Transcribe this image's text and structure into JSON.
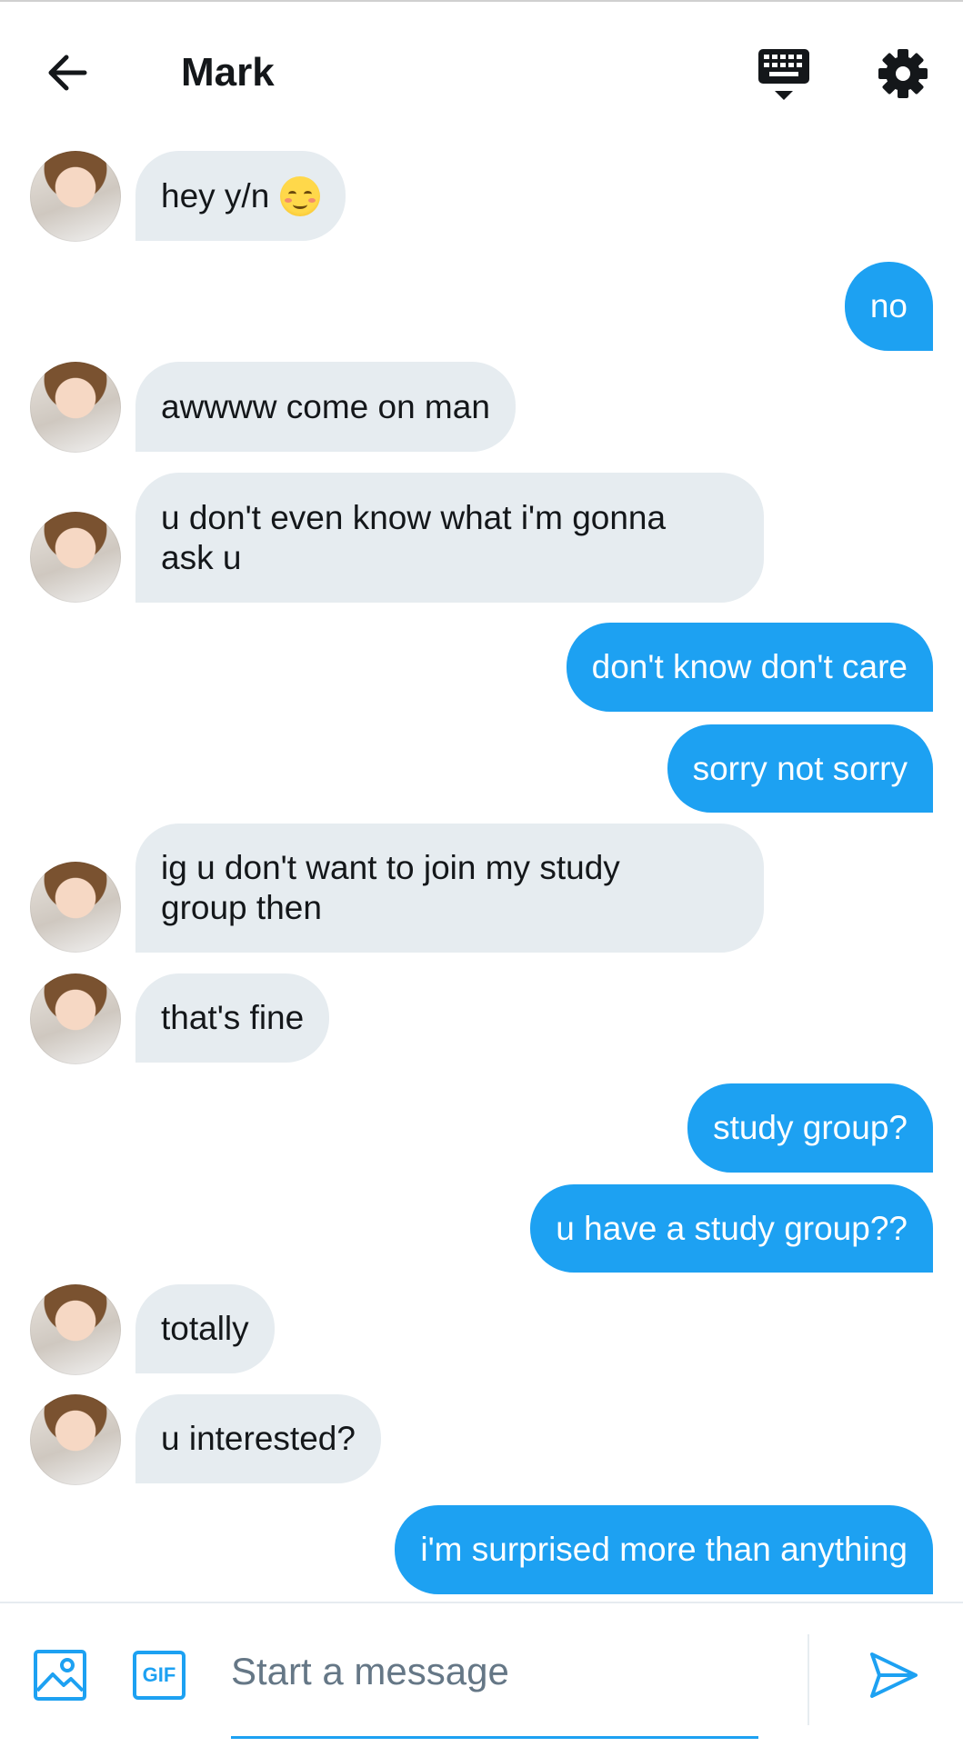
{
  "header": {
    "title": "Mark"
  },
  "colors": {
    "accent": "#1da1f2",
    "incoming_bubble": "#e6ecf0",
    "text": "#14171a",
    "placeholder": "#657786"
  },
  "messages": [
    {
      "direction": "in",
      "text": "hey y/n",
      "emoji": "smiling-blush-emoji"
    },
    {
      "direction": "out",
      "text": "no"
    },
    {
      "direction": "in",
      "text": "awwww come on man"
    },
    {
      "direction": "in",
      "text": "u don't even know what i'm gonna\nask u"
    },
    {
      "direction": "out",
      "text": "don't know don't care"
    },
    {
      "direction": "out",
      "text": "sorry not sorry"
    },
    {
      "direction": "in",
      "text": "ig u don't want to join my study\ngroup then"
    },
    {
      "direction": "in",
      "text": "that's fine"
    },
    {
      "direction": "out",
      "text": "study group?"
    },
    {
      "direction": "out",
      "text": "u have a study group??"
    },
    {
      "direction": "in",
      "text": "totally"
    },
    {
      "direction": "in",
      "text": "u interested?"
    },
    {
      "direction": "out",
      "text": "i'm surprised more than anything"
    }
  ],
  "composer": {
    "placeholder": "Start a message",
    "value": "",
    "gif_label": "GIF"
  },
  "icons": {
    "back": "arrow-left-icon",
    "keyboard": "keyboard-icon",
    "settings": "gear-icon",
    "image": "image-icon",
    "gif": "gif-icon",
    "send": "send-icon"
  }
}
